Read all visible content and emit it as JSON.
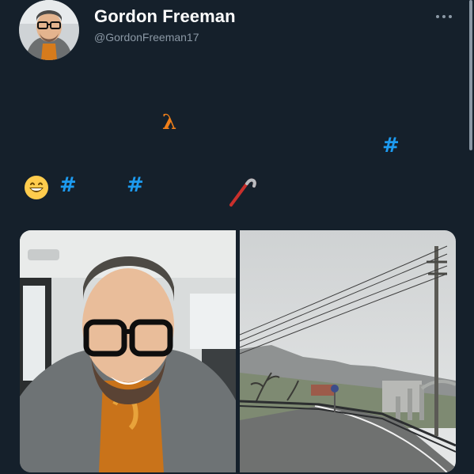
{
  "profile": {
    "display_name": "Gordon Freeman",
    "handle": "@GordonFreeman17",
    "avatar_icon": "avatar-photo"
  },
  "header": {
    "more_icon": "more-horizontal-icon"
  },
  "tweet": {
    "lambda_symbol": "λ",
    "hashtags": [
      "#",
      "#",
      "#"
    ],
    "emoji": "grinning-face-icon",
    "crowbar": "crowbar-icon"
  },
  "media": [
    {
      "name": "selfie-photo",
      "description_icon": "photo"
    },
    {
      "name": "road-photo",
      "description_icon": "photo"
    }
  ],
  "colors": {
    "background": "#15202b",
    "text_primary": "#ffffff",
    "text_secondary": "#8b98a5",
    "link_blue": "#1d9bf0",
    "lambda_orange": "#f07f19"
  }
}
